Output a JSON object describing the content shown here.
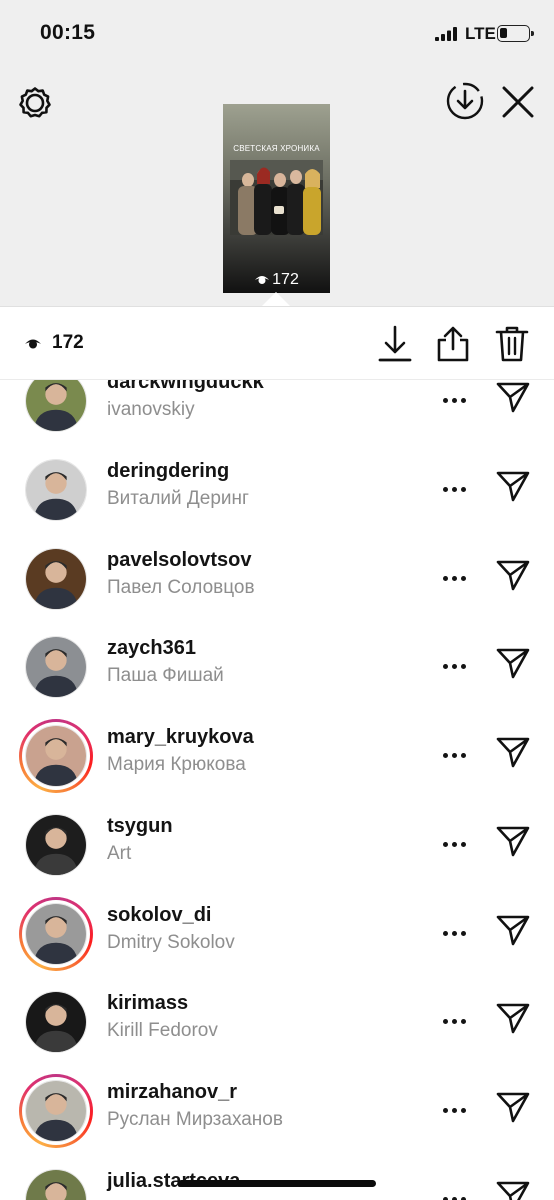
{
  "status_bar": {
    "time": "00:15",
    "network": "LTE",
    "battery_level": 0.25
  },
  "story": {
    "thumbnail_caption": "СВЕТСКАЯ ХРОНИКА",
    "thumbnail_views": "172",
    "icons": [
      "gear-icon",
      "download-circle-icon",
      "close-icon"
    ]
  },
  "viewers_bar": {
    "count": "172",
    "icons": [
      "eye-icon",
      "download-icon",
      "share-icon",
      "trash-icon"
    ]
  },
  "viewers": [
    {
      "username": "darckwingduckk",
      "name": "ivanovskiy",
      "ring": false,
      "avatar_color": "#7a8a4e"
    },
    {
      "username": "deringdering",
      "name": "Виталий Деринг",
      "ring": false,
      "avatar_color": "#cfcfcf"
    },
    {
      "username": "pavelsolovtsov",
      "name": "Павел Соловцов",
      "ring": false,
      "avatar_color": "#5a3b22"
    },
    {
      "username": "zaych361",
      "name": "Паша Фишай",
      "ring": false,
      "avatar_color": "#8c8f93"
    },
    {
      "username": "mary_kruykova",
      "name": "Мария Крюкова",
      "ring": true,
      "avatar_color": "#c9a28f"
    },
    {
      "username": "tsygun",
      "name": "Art",
      "ring": false,
      "avatar_color": "#1d1d1d"
    },
    {
      "username": "sokolov_di",
      "name": "Dmitry Sokolov",
      "ring": true,
      "avatar_color": "#9a9a9a"
    },
    {
      "username": "kirimass",
      "name": "Kirill Fedorov",
      "ring": false,
      "avatar_color": "#181818"
    },
    {
      "username": "mirzahanov_r",
      "name": "Руслан Мирзаханов",
      "ring": true,
      "avatar_color": "#b9b7ae"
    },
    {
      "username": "julia.startceva",
      "name": "",
      "ring": false,
      "avatar_color": "#6f7a4a"
    }
  ],
  "colors": {
    "header_bg": "#efefef",
    "secondary_text": "#8e8e8e",
    "story_ring": [
      "#c13584",
      "#fd1d1d",
      "#fcaf45"
    ]
  }
}
